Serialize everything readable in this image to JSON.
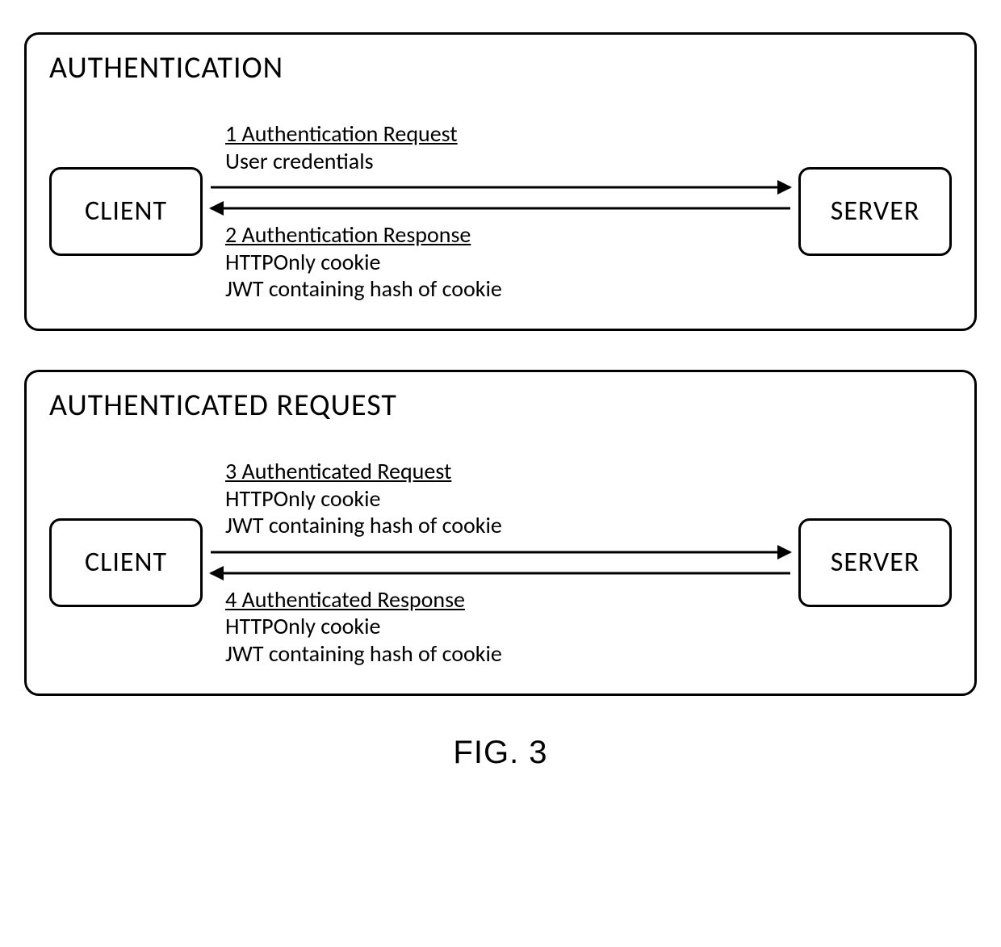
{
  "panels": [
    {
      "title": "AUTHENTICATION",
      "left_node": "CLIENT",
      "right_node": "SERVER",
      "top_msg_header": "1 Authentication Request",
      "top_msg_body": "User credentials",
      "bottom_msg_header": "2 Authentication Response",
      "bottom_msg_body": "HTTPOnly cookie\nJWT containing hash of cookie"
    },
    {
      "title": "AUTHENTICATED REQUEST",
      "left_node": "CLIENT",
      "right_node": "SERVER",
      "top_msg_header": "3 Authenticated Request",
      "top_msg_body": "HTTPOnly cookie\nJWT containing hash of cookie",
      "bottom_msg_header": "4 Authenticated Response",
      "bottom_msg_body": "HTTPOnly cookie\nJWT containing hash of cookie"
    }
  ],
  "figure_caption": "FIG. 3"
}
